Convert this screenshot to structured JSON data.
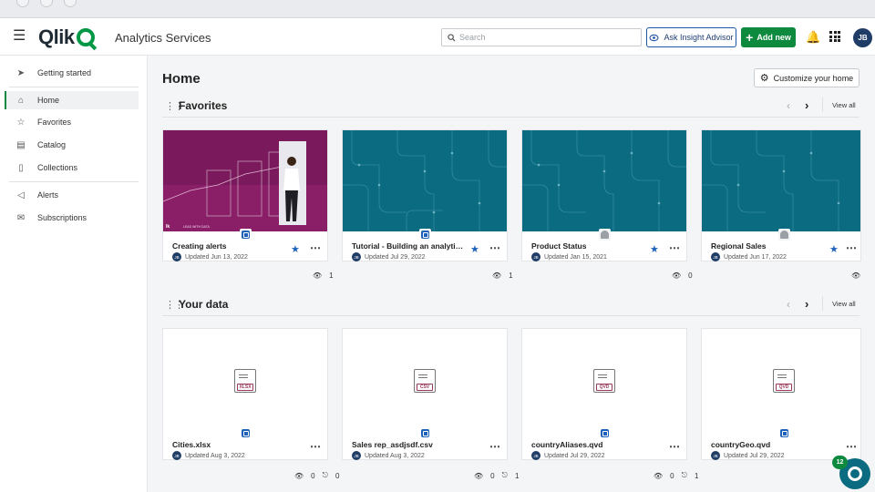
{
  "header": {
    "app_name": "Analytics Services",
    "search_placeholder": "Search",
    "ask_label": "Ask Insight Advisor",
    "add_label": "Add new",
    "avatar_initials": "JB",
    "brand_green": "#009845"
  },
  "sidebar": {
    "items": [
      {
        "label": "Getting started",
        "icon": "rocket-icon"
      },
      {
        "label": "Home",
        "icon": "home-icon"
      },
      {
        "label": "Favorites",
        "icon": "star-icon"
      },
      {
        "label": "Catalog",
        "icon": "catalog-icon"
      },
      {
        "label": "Collections",
        "icon": "bookmark-icon"
      },
      {
        "label": "Alerts",
        "icon": "alert-icon"
      },
      {
        "label": "Subscriptions",
        "icon": "mail-icon"
      }
    ],
    "active": "Home"
  },
  "main": {
    "title": "Home",
    "customize_label": "Customize your home",
    "favorites": {
      "title": "Favorites",
      "view_all": "View all",
      "cards": [
        {
          "title": "Creating alerts",
          "initials": "JB",
          "updated": "Updated Jun 13, 2022",
          "views": "1",
          "thumb_text": "LEAD WITH DATA"
        },
        {
          "title": "Tutorial - Building an analytics ...",
          "initials": "JB",
          "updated": "Updated Jul 29, 2022",
          "views": "1"
        },
        {
          "title": "Product Status",
          "initials": "JB",
          "updated": "Updated Jan 15, 2021",
          "views": "0"
        },
        {
          "title": "Regional Sales",
          "initials": "JB",
          "updated": "Updated Jun 17, 2022"
        }
      ]
    },
    "your_data": {
      "title": "Your data",
      "view_all": "View all",
      "cards": [
        {
          "title": "Cities.xlsx",
          "initials": "JB",
          "updated": "Updated Aug 3, 2022",
          "ext": "XLSX",
          "views": "0",
          "lineage": "0"
        },
        {
          "title": "Sales rep_asdjsdf.csv",
          "initials": "JB",
          "updated": "Updated Aug 3, 2022",
          "ext": "CSV",
          "views": "0",
          "lineage": "1"
        },
        {
          "title": "countryAliases.qvd",
          "initials": "JB",
          "updated": "Updated Jul 29, 2022",
          "ext": "QVD",
          "views": "0",
          "lineage": "1"
        },
        {
          "title": "countryGeo.qvd",
          "initials": "JB",
          "updated": "Updated Jul 29, 2022",
          "ext": "QVD"
        }
      ]
    }
  },
  "notification_count": "12",
  "colors": {
    "accent_green": "#0e8a3e",
    "teal": "#0b6b80",
    "magenta": "#7a1a5c",
    "blue": "#1d62b8"
  }
}
